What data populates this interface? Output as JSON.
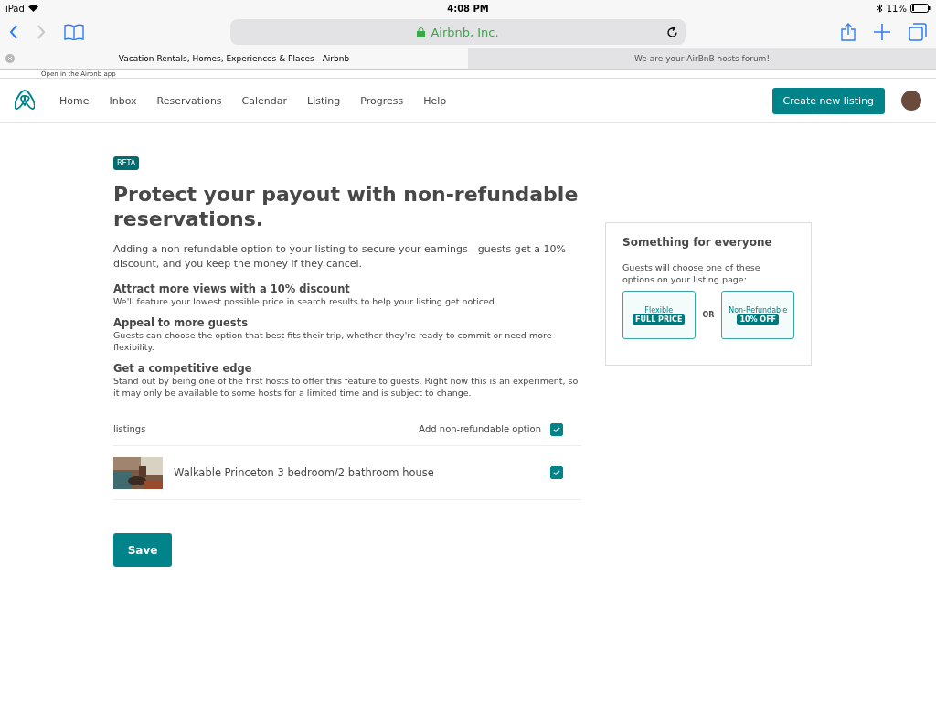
{
  "status_bar": {
    "device": "iPad",
    "time": "4:08 PM",
    "battery": "11%"
  },
  "browser": {
    "address": "Airbnb, Inc.",
    "tabs": [
      {
        "title": "Vacation Rentals, Homes, Experiences & Places - Airbnb",
        "selected": true
      },
      {
        "title": "We are your AirBnB hosts forum!",
        "selected": false
      }
    ],
    "banner": "Open in the Airbnb app"
  },
  "nav": {
    "items": [
      {
        "label": "Home"
      },
      {
        "label": "Inbox"
      },
      {
        "label": "Reservations"
      },
      {
        "label": "Calendar"
      },
      {
        "label": "Listing"
      },
      {
        "label": "Progress"
      },
      {
        "label": "Help"
      }
    ],
    "cta": "Create new listing"
  },
  "main": {
    "badge": "BETA",
    "title": "Protect your payout with non-refundable reservations.",
    "intro": "Adding a non-refundable option to your listing to secure your earnings—guests get a 10% discount, and you keep the money if they cancel.",
    "features": [
      {
        "heading": "Attract more views with a 10% discount",
        "body": "We'll feature your lowest possible price in search results to help your listing get noticed."
      },
      {
        "heading": "Appeal to more guests",
        "body": "Guests can choose the option that best fits their trip, whether they're ready to commit or need more flexibility."
      },
      {
        "heading": "Get a competitive edge",
        "body": "Stand out by being one of the first hosts to offer this feature to guests. Right now this is an experiment, so it may only be available to some hosts for a limited time and is subject to change."
      }
    ],
    "table": {
      "column_1": "listings",
      "column_2": "Add non-refundable option",
      "all_checked": true,
      "rows": [
        {
          "name": "Walkable Princeton 3 bedroom/2 bathroom house",
          "checked": true
        }
      ]
    },
    "save": "Save"
  },
  "sidebar": {
    "title": "Something for everyone",
    "text": "Guests will choose one of these options on your listing page:",
    "options": [
      {
        "label": "Flexible",
        "tag": "FULL PRICE"
      },
      {
        "label": "Non-Refundable",
        "tag": "10% OFF"
      }
    ],
    "separator": "OR"
  }
}
